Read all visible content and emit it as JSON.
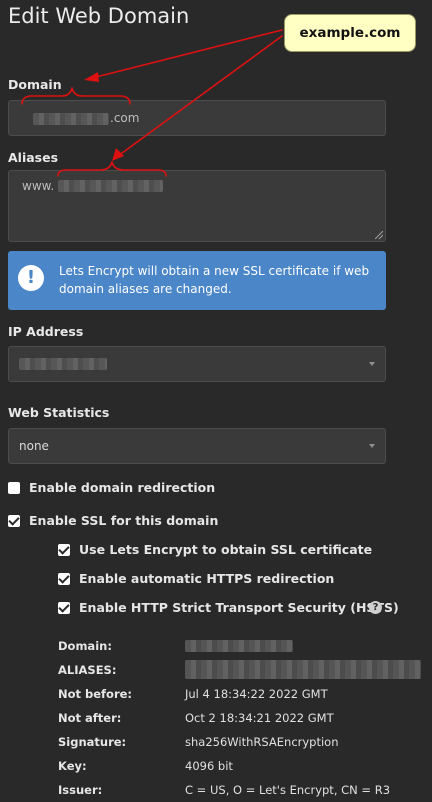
{
  "title": "Edit Web Domain",
  "callout": {
    "text": "example.com"
  },
  "domain": {
    "label": "Domain",
    "value_suffix": ".com"
  },
  "aliases": {
    "label": "Aliases",
    "value_prefix": "www."
  },
  "alert": {
    "icon": "exclamation-circle-icon",
    "text": "Lets Encrypt will obtain a new SSL certificate if web domain aliases are changed."
  },
  "ip": {
    "label": "IP Address"
  },
  "stats": {
    "label": "Web Statistics",
    "value": "none"
  },
  "options": {
    "redirect": {
      "label": "Enable domain redirection",
      "checked": false
    },
    "ssl": {
      "label": "Enable SSL for this domain",
      "checked": true
    },
    "letsencrypt": {
      "label": "Use Lets Encrypt to obtain SSL certificate",
      "checked": true
    },
    "https": {
      "label": "Enable automatic HTTPS redirection",
      "checked": true
    },
    "hsts": {
      "label": "Enable HTTP Strict Transport Security (HSTS)",
      "checked": true,
      "help_icon": "question-circle-icon"
    }
  },
  "cert": {
    "domain_label": "Domain:",
    "aliases_label": "ALIASES:",
    "not_before_label": "Not before:",
    "not_before": "Jul 4 18:34:22 2022 GMT",
    "not_after_label": "Not after:",
    "not_after": "Oct 2 18:34:21 2022 GMT",
    "signature_label": "Signature:",
    "signature": "sha256WithRSAEncryption",
    "key_label": "Key:",
    "key": "4096 bit",
    "issuer_label": "Issuer:",
    "issuer": "C = US, O = Let's Encrypt, CN = R3"
  },
  "colors": {
    "background": "#292929",
    "alert": "#4a86c8",
    "annotation": "#dd1111",
    "callout": "#ffffc4"
  }
}
